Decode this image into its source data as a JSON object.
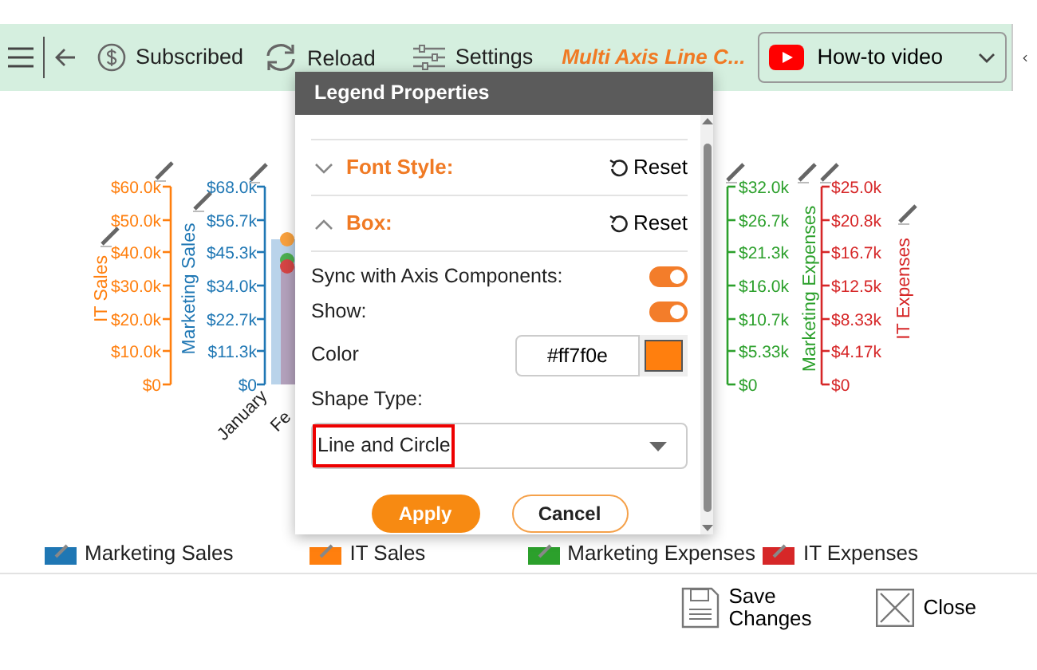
{
  "toolbar": {
    "items": [
      {
        "kind": "subscribed",
        "label": "Subscribed"
      },
      {
        "kind": "reload",
        "label": "Reload"
      },
      {
        "kind": "settings",
        "label": "Settings"
      }
    ],
    "title": "Multi Axis Line C...",
    "video_button": "How-to video"
  },
  "chart": {
    "axes": [
      {
        "title": "IT Sales",
        "color": "#ff7f0e",
        "ticks": [
          "$60.0k",
          "$50.0k",
          "$40.0k",
          "$30.0k",
          "$20.0k",
          "$10.0k",
          "$0"
        ]
      },
      {
        "title": "Marketing Sales",
        "color": "#1f77b4",
        "ticks": [
          "$68.0k",
          "$56.7k",
          "$45.3k",
          "$34.0k",
          "$22.7k",
          "$11.3k",
          "$0"
        ]
      },
      {
        "title": "Marketing Expenses",
        "color": "#2ca02c",
        "ticks": [
          "$32.0k",
          "$26.7k",
          "$21.3k",
          "$16.0k",
          "$10.7k",
          "$5.33k",
          "$0"
        ]
      },
      {
        "title": "IT Expenses",
        "color": "#d62728",
        "ticks": [
          "$25.0k",
          "$20.8k",
          "$16.7k",
          "$12.5k",
          "$8.33k",
          "$4.17k",
          "$0"
        ]
      }
    ],
    "x_labels": [
      "January",
      "Fe"
    ]
  },
  "dialog": {
    "title": "Legend Properties",
    "sections": [
      {
        "label": "Font Style:",
        "expanded": false,
        "reset": "Reset"
      },
      {
        "label": "Box:",
        "expanded": true,
        "reset": "Reset"
      }
    ],
    "toggles": [
      {
        "label": "Sync with Axis Components:",
        "on": true
      },
      {
        "label": "Show:",
        "on": true
      }
    ],
    "color": {
      "label": "Color",
      "value": "#ff7f0e"
    },
    "shape": {
      "label": "Shape Type:",
      "value": "Line and Circle",
      "highlighted": true
    },
    "buttons": {
      "apply": "Apply",
      "cancel": "Cancel"
    }
  },
  "legend": [
    {
      "label": "Marketing Sales",
      "color": "#1f77b4"
    },
    {
      "label": "IT Sales",
      "color": "#ff7f0e"
    },
    {
      "label": "Marketing Expenses",
      "color": "#2ca02c"
    },
    {
      "label": "IT Expenses",
      "color": "#d62728"
    }
  ],
  "footer": {
    "save": "Save Changes",
    "close": "Close"
  }
}
